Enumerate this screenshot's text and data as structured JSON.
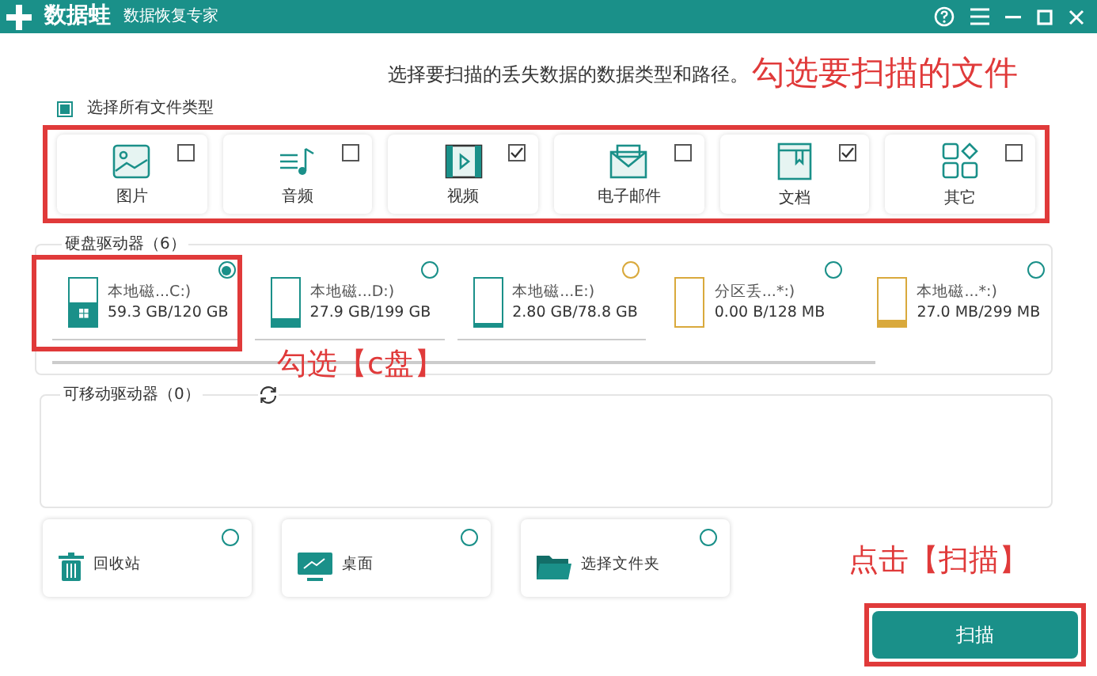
{
  "window": {
    "app_name": "数据蛙",
    "subtitle": "数据恢复专家"
  },
  "instruction": "选择要扫描的丢失数据的数据类型和路径。",
  "annotation_types": "勾选要扫描的文件",
  "select_all": {
    "label": "选择所有文件类型",
    "checked": true
  },
  "file_types": [
    {
      "kind": "image",
      "label": "图片",
      "checked": false
    },
    {
      "kind": "audio",
      "label": "音频",
      "checked": false
    },
    {
      "kind": "video",
      "label": "视频",
      "checked": true
    },
    {
      "kind": "email",
      "label": "电子邮件",
      "checked": false
    },
    {
      "kind": "document",
      "label": "文档",
      "checked": true
    },
    {
      "kind": "other",
      "label": "其它",
      "checked": false
    }
  ],
  "hard_drives": {
    "title": "硬盘驱动器（6）",
    "drives": [
      {
        "name": "本地磁...C:)",
        "size": "59.3 GB/120 GB",
        "level": 0.5,
        "color": "#1a9089",
        "radio": {
          "color": "#1a9089"
        },
        "system": true,
        "selected": true
      },
      {
        "name": "本地磁...D:)",
        "size": "27.9 GB/199 GB",
        "level": 0.15,
        "color": "#1a9089",
        "radio": {
          "color": "#1a9089"
        },
        "system": false,
        "selected": false
      },
      {
        "name": "本地磁...E:)",
        "size": "2.80 GB/78.8 GB",
        "level": 0.04,
        "color": "#1a9089",
        "radio": {
          "color": "#d9a93c"
        },
        "system": false,
        "selected": false
      },
      {
        "name": "分区丢...*:)",
        "size": "0.00  B/128 MB",
        "level": 0,
        "color": "#d9a93c",
        "radio": {
          "color": "#1a9089"
        },
        "system": false,
        "selected": false
      },
      {
        "name": "本地磁...*:)",
        "size": "27.0 MB/299 MB",
        "level": 0.12,
        "color": "#d9a93c",
        "radio": {
          "color": "#1a9089"
        },
        "system": false,
        "selected": false
      }
    ]
  },
  "annotation_drive": "勾选【c盘】",
  "removable_drives": {
    "title": "可移动驱动器（0）"
  },
  "locations": [
    {
      "kind": "recycle",
      "label": "回收站",
      "selected": false
    },
    {
      "kind": "desktop",
      "label": "桌面",
      "selected": false
    },
    {
      "kind": "folder",
      "label": "选择文件夹",
      "selected": false
    }
  ],
  "annotation_scan": "点击【扫描】",
  "scan_button": "扫描"
}
